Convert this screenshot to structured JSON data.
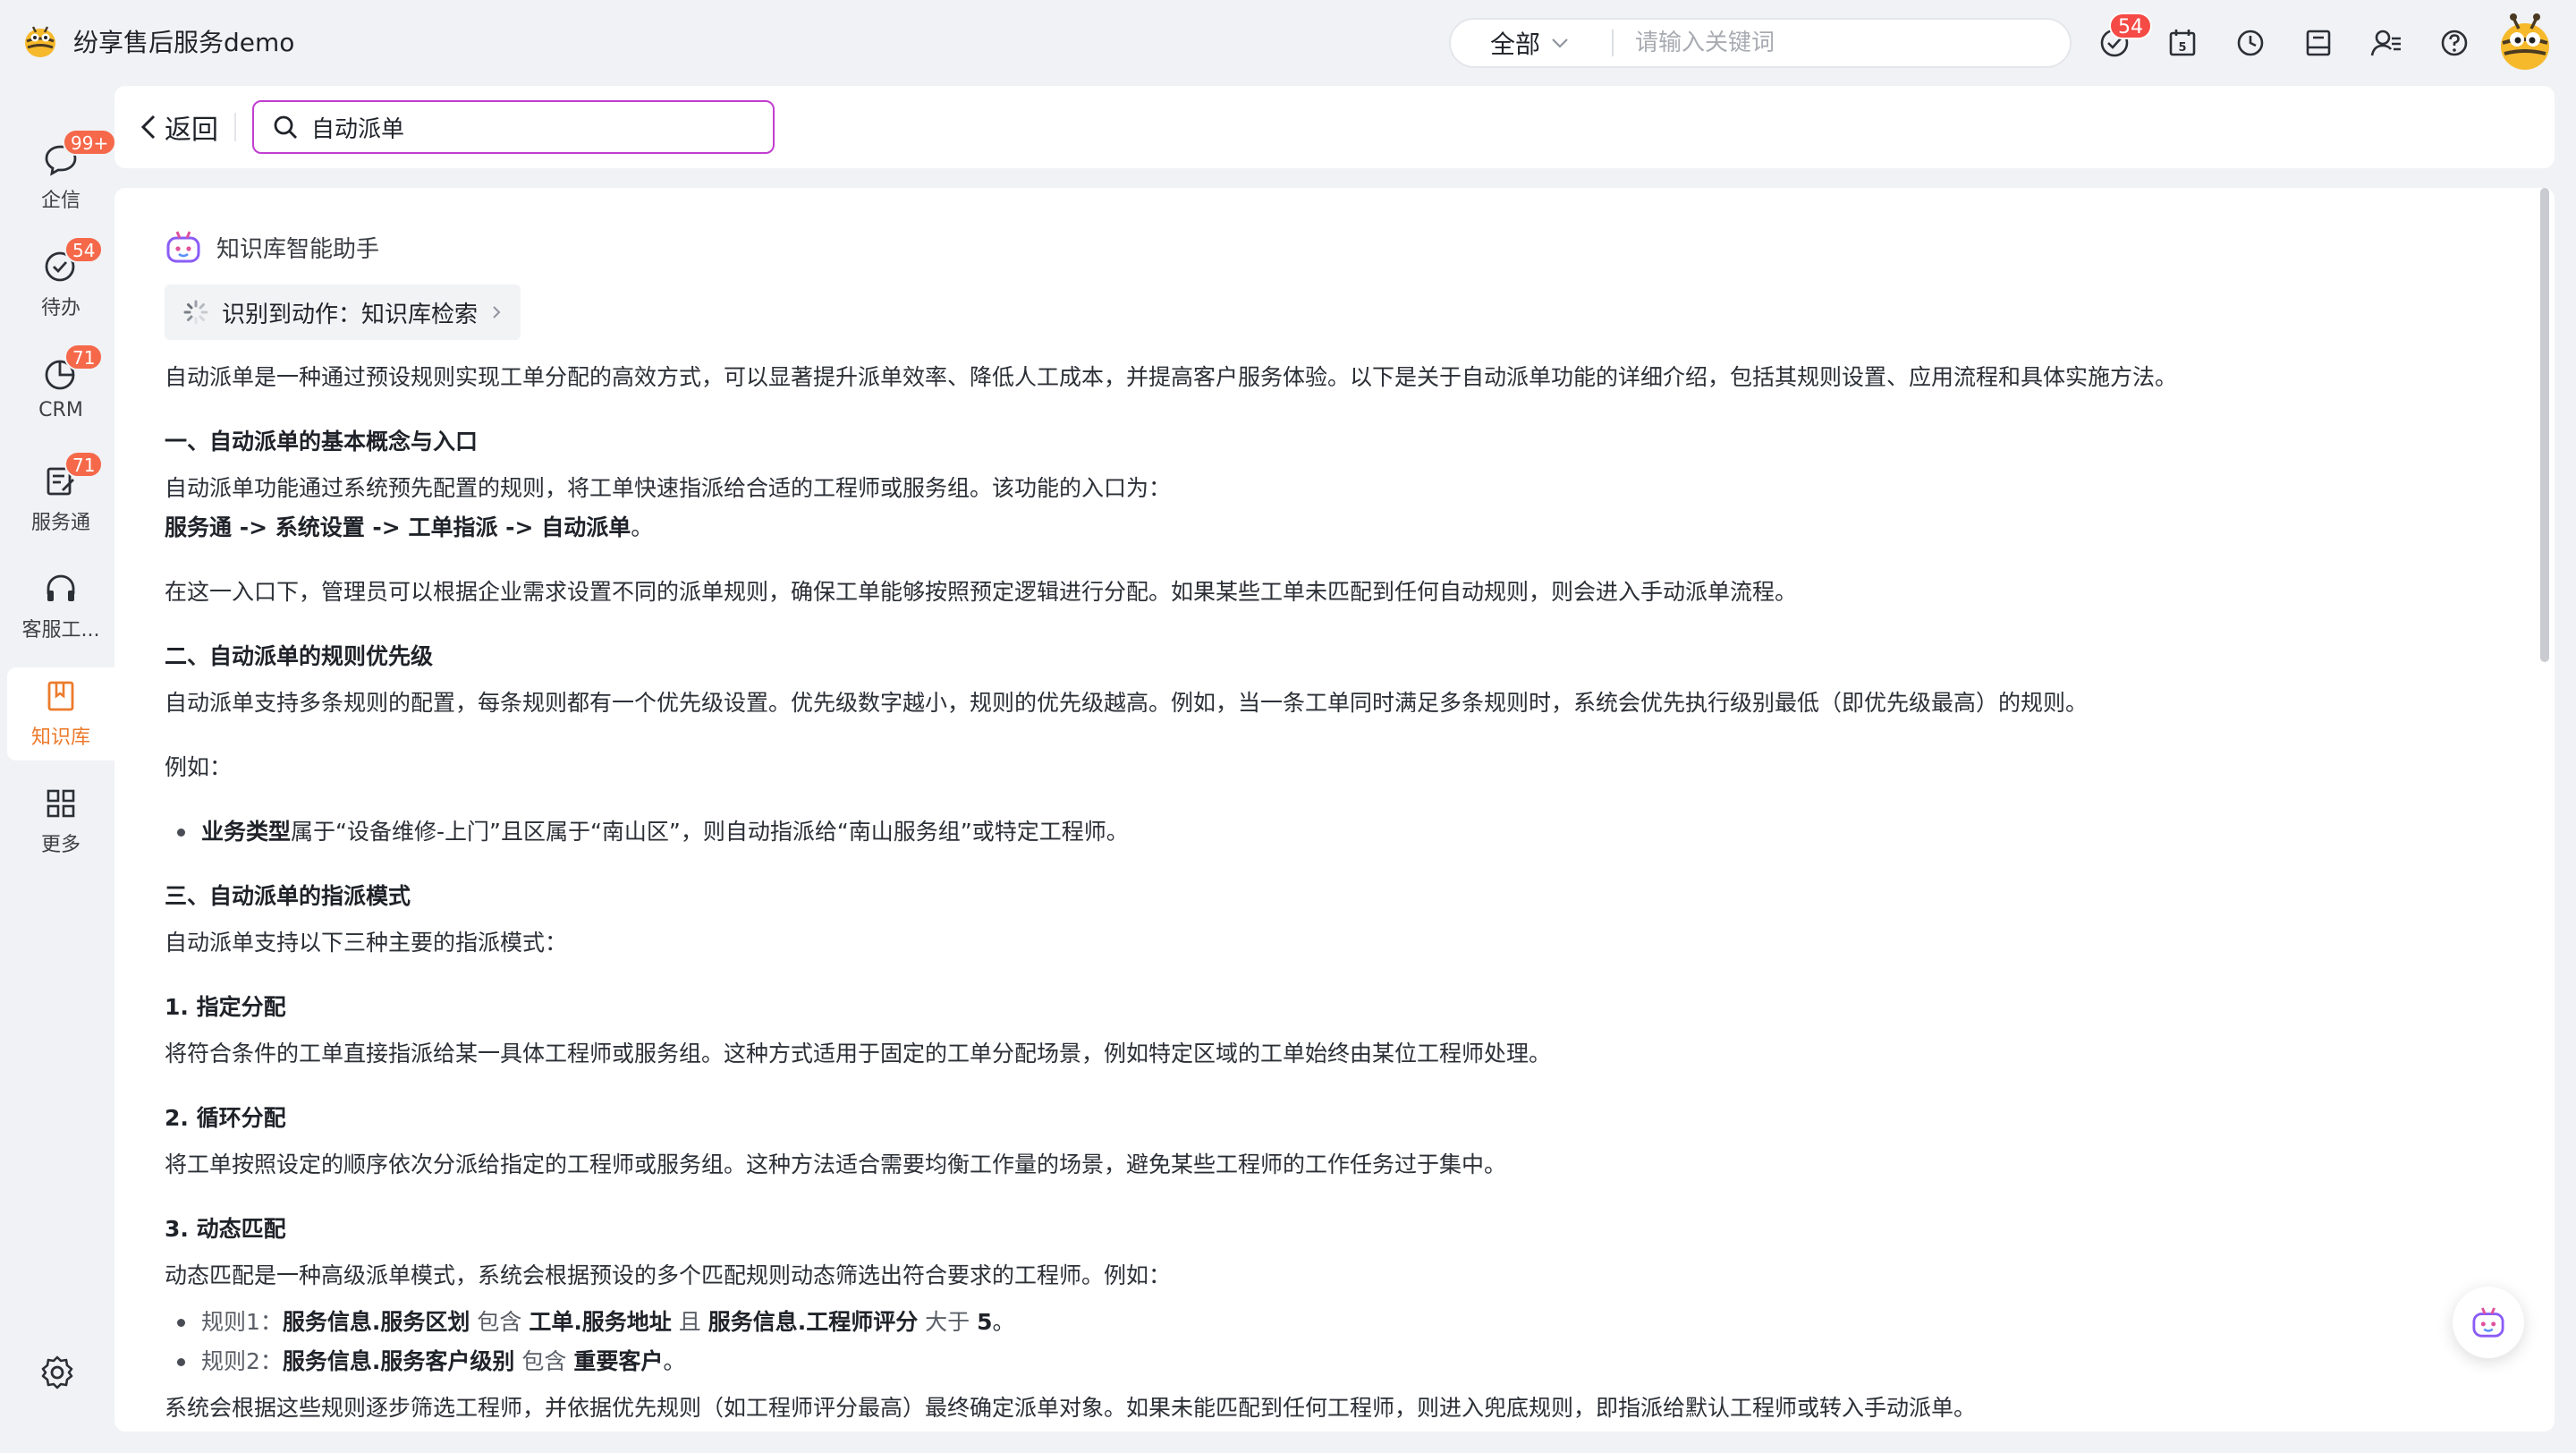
{
  "app": {
    "title": "纷享售后服务demo",
    "logo_icon": "bee-logo-icon"
  },
  "header": {
    "scope_label": "全部",
    "search_placeholder": "请输入关键词",
    "todo_badge": "54",
    "icons": [
      "todo-check-icon",
      "calendar-icon",
      "clock-icon",
      "notes-icon",
      "contacts-icon",
      "help-icon"
    ]
  },
  "sidebar": {
    "items": [
      {
        "label": "企信",
        "icon": "chat-icon",
        "badge": "99+"
      },
      {
        "label": "待办",
        "icon": "check-circle-icon",
        "badge": "54"
      },
      {
        "label": "CRM",
        "icon": "pie-chart-icon",
        "badge": "71"
      },
      {
        "label": "服务通",
        "icon": "service-icon",
        "badge": "71"
      },
      {
        "label": "客服工...",
        "icon": "headset-icon",
        "badge": ""
      },
      {
        "label": "知识库",
        "icon": "book-icon",
        "badge": ""
      },
      {
        "label": "更多",
        "icon": "grid-icon",
        "badge": ""
      }
    ],
    "settings_icon": "gear-icon"
  },
  "search_bar": {
    "back_label": "返回",
    "keyword": "自动派单"
  },
  "assistant": {
    "title": "知识库智能助手",
    "action_text": "识别到动作：知识库检索"
  },
  "article": {
    "intro": "自动派单是一种通过预设规则实现工单分配的高效方式，可以显著提升派单效率、降低人工成本，并提高客户服务体验。以下是关于自动派单功能的详细介绍，包括其规则设置、应用流程和具体实施方法。",
    "s1_title": "一、自动派单的基本概念与入口",
    "s1_p1": "自动派单功能通过系统预先配置的规则，将工单快速指派给合适的工程师或服务组。该功能的入口为：",
    "s1_path": "服务通 -> 系统设置 -> 工单指派 -> 自动派单",
    "s1_path_end": "。",
    "s1_p2": "在这一入口下，管理员可以根据企业需求设置不同的派单规则，确保工单能够按照预定逻辑进行分配。如果某些工单未匹配到任何自动规则，则会进入手动派单流程。",
    "s2_title": "二、自动派单的规则优先级",
    "s2_p1": "自动派单支持多条规则的配置，每条规则都有一个优先级设置。优先级数字越小，规则的优先级越高。例如，当一条工单同时满足多条规则时，系统会优先执行级别最低（即优先级最高）的规则。",
    "s2_example": "例如：",
    "s2_li_bold": "业务类型",
    "s2_li_rest": "属于“设备维修-上门”且区属于“南山区”，则自动指派给“南山服务组”或特定工程师。",
    "s3_title": "三、自动派单的指派模式",
    "s3_p1": "自动派单支持以下三种主要的指派模式：",
    "m1_title": "1. 指定分配",
    "m1_p": "将符合条件的工单直接指派给某一具体工程师或服务组。这种方式适用于固定的工单分配场景，例如特定区域的工单始终由某位工程师处理。",
    "m2_title": "2. 循环分配",
    "m2_p": "将工单按照设定的顺序依次分派给指定的工程师或服务组。这种方法适合需要均衡工作量的场景，避免某些工程师的工作任务过于集中。",
    "m3_title": "3. 动态匹配",
    "m3_p": "动态匹配是一种高级派单模式，系统会根据预设的多个匹配规则动态筛选出符合要求的工程师。例如：",
    "rule1": {
      "prefix": "规则1：",
      "field1": "服务信息.服务区划",
      "op1": " 包含 ",
      "field2": "工单.服务地址",
      "op2": " 且 ",
      "field3": "服务信息.工程师评分",
      "op3": " 大于 ",
      "value": "5",
      "end": "。"
    },
    "rule2": {
      "prefix": "规则2：",
      "field1": "服务信息.服务客户级别",
      "op1": " 包含 ",
      "field2": "重要客户",
      "end": "。"
    },
    "cut_line": "系统会根据这些规则逐步筛选工程师，并依据优先规则（如工程师评分最高）最终确定派单对象。如果未能匹配到任何工程师，则进入兜底规则，即指派给默认工程师或转入手动派单。"
  },
  "fab": {
    "icon": "robot-assistant-icon"
  },
  "colors": {
    "accent": "#ec7b2c",
    "badge": "#f54a45",
    "search_border": "#c13ed0"
  }
}
